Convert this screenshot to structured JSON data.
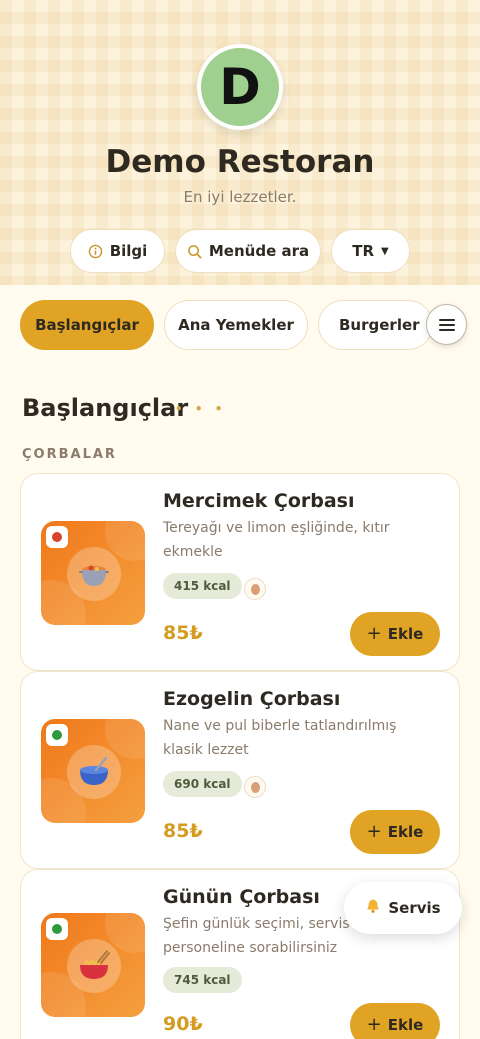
{
  "brand": {
    "logo_letter": "D",
    "name": "Demo Restoran",
    "tagline": "En iyi lezzetler."
  },
  "actions": {
    "info_label": "Bilgi",
    "search_label": "Menüde ara",
    "language": "TR"
  },
  "categories": [
    {
      "label": "Başlangıçlar",
      "active": true
    },
    {
      "label": "Ana Yemekler",
      "active": false
    },
    {
      "label": "Burgerler",
      "active": false
    }
  ],
  "section": {
    "title": "Başlangıçlar",
    "dots": "• • •",
    "subsection": "ÇORBALAR"
  },
  "items": [
    {
      "name": "Mercimek Çorbası",
      "description": "Tereyağı ve limon eşliğinde, kıtır ekmekle",
      "kcal": "415 kcal",
      "price": "85₺",
      "add_label": "Ekle",
      "diet_color": "#d8432b",
      "icon": "soup-pot-icon",
      "allergen": "egg-icon"
    },
    {
      "name": "Ezogelin Çorbası",
      "description": "Nane ve pul biberle tatlandırılmış klasik lezzet",
      "kcal": "690 kcal",
      "price": "85₺",
      "add_label": "Ekle",
      "diet_color": "#2e9a3e",
      "icon": "soup-bowl-icon",
      "allergen": "egg-icon"
    },
    {
      "name": "Günün Çorbası",
      "description": "Şefin günlük seçimi, servis personeline sorabilirsiniz",
      "kcal": "745 kcal",
      "price": "90₺",
      "add_label": "Ekle",
      "diet_color": "#2e9a3e",
      "icon": "noodle-bowl-icon"
    }
  ],
  "service_button": {
    "label": "Servis",
    "icon": "bell-icon"
  },
  "colors": {
    "accent": "#e0a324",
    "price": "#d59b21",
    "background": "#fffbef"
  }
}
